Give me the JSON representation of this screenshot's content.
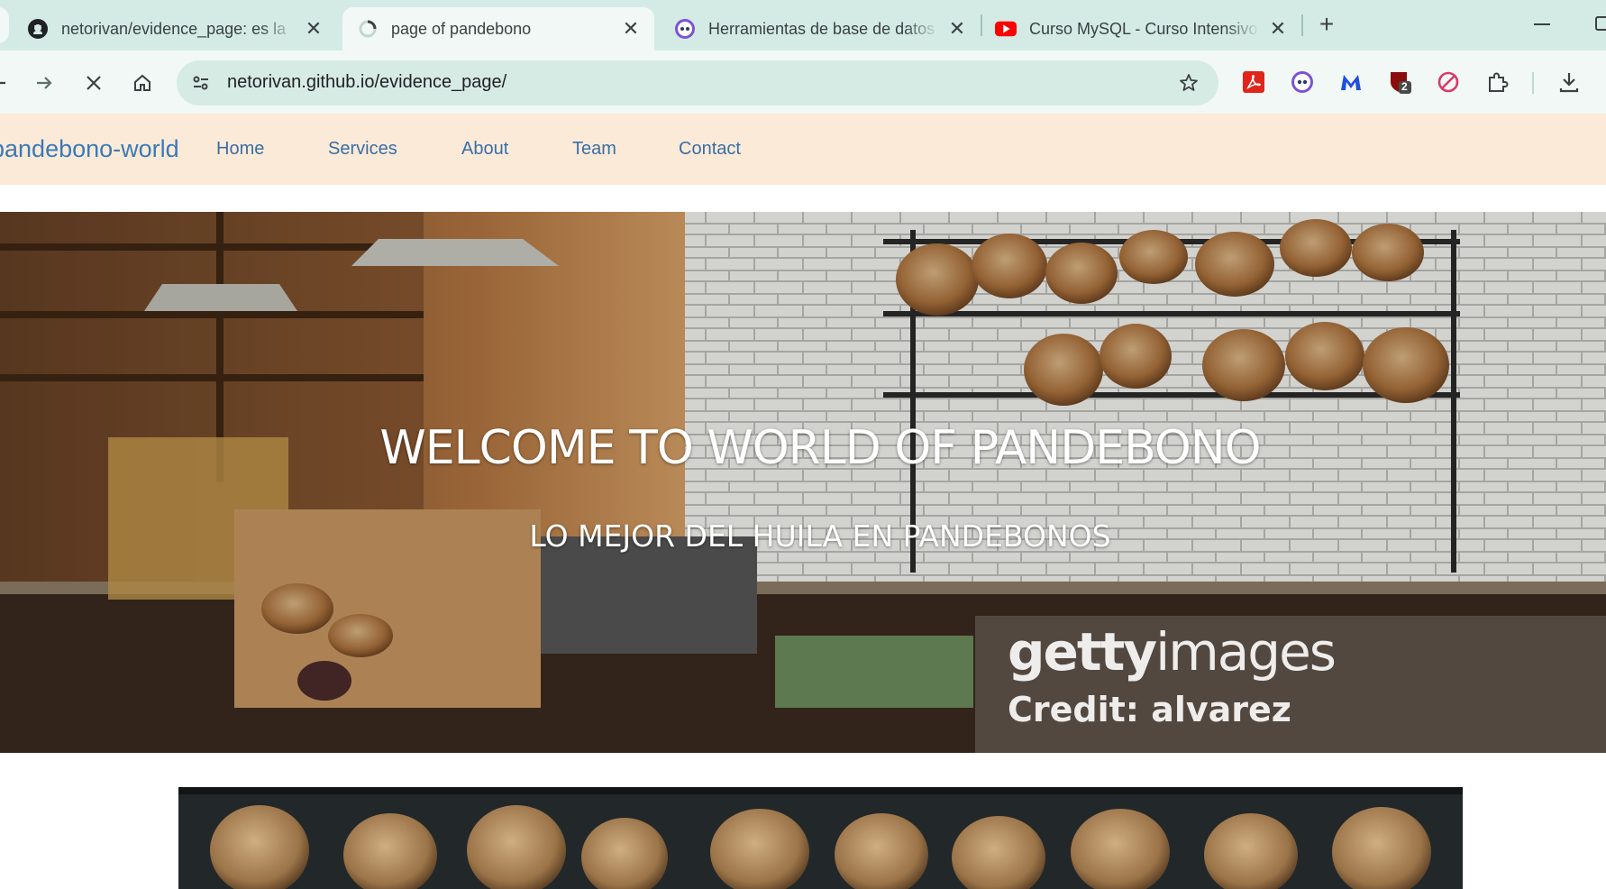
{
  "browser": {
    "tabs": [
      {
        "title": "netorivan/evidence_page: es la ",
        "favicon": "github-icon",
        "active": false
      },
      {
        "title": "page of pandebono",
        "favicon": "page-loading-icon",
        "active": true
      },
      {
        "title": "Herramientas de base de datos",
        "favicon": "devtools-ext-icon",
        "active": false
      },
      {
        "title": "Curso MySQL - Curso Intensivo",
        "favicon": "youtube-icon",
        "active": false
      }
    ],
    "new_tab_glyph": "+",
    "url": "netorivan.github.io/evidence_page/",
    "extensions": [
      "pdf-extension-icon",
      "devtools-extension-icon",
      "malwarebytes-extension-icon",
      "ublock-extension-icon",
      "block-extension-icon",
      "puzzle-extensions-icon"
    ],
    "ublock_badge": "2",
    "colors": {
      "tabstrip": "#d3ebe4",
      "toolbar": "#f1f8f5",
      "omnibox": "#d7ebe5"
    }
  },
  "site": {
    "brand": "pandebono-world",
    "nav": [
      "Home",
      "Services",
      "About",
      "Team",
      "Contact"
    ],
    "hero": {
      "title": "WELCOME TO WORLD OF PANDEBONO",
      "subtitle": "LO MEJOR DEL HUILA EN PANDEBONOS",
      "watermark_brand_bold": "getty",
      "watermark_brand_light": "images",
      "watermark_credit": "Credit: alvarez"
    },
    "colors": {
      "nav_bg": "#fbead8",
      "link": "#3a6ea5",
      "brand": "#3a7ab8"
    }
  }
}
